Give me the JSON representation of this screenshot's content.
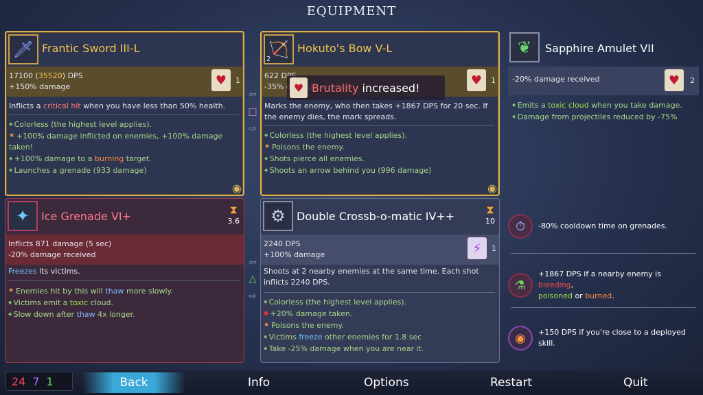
{
  "title": "EQUIPMENT",
  "sword": {
    "name": "Frantic Sword III-L",
    "dps_base": "17100",
    "dps_bonus": "35520",
    "dps_unit": "DPS",
    "damage": "+150% damage",
    "scroll_count": "1",
    "desc_pre": "Inflicts a ",
    "desc_hl": "critical hit",
    "desc_post": " when you have less than 50% health.",
    "mods": [
      "Colorless (the highest level applies).",
      "+100% damage inflicted on enemies, +100% damage taken!",
      "+100% damage to a ",
      "burning",
      " target.",
      "Launches a grenade (933 damage)"
    ]
  },
  "bow": {
    "name": "Hokuto's Bow V-L",
    "badge": "2",
    "dps": "622 DPS",
    "damage": "-35% damage received",
    "scroll_count": "1",
    "desc": "Marks the enemy, who then takes +1867 DPS for 20 sec. If the enemy dies, the mark spreads.",
    "mods": [
      "Colorless (the highest level applies).",
      "Poisons the enemy.",
      "Shots pierce all enemies.",
      "Shoots an arrow behind you (996 damage)"
    ]
  },
  "popup": {
    "word": "Brutality",
    "rest": " increased!"
  },
  "amulet": {
    "name": "Sapphire Amulet VII",
    "stat": "-20% damage received",
    "scroll_count": "2",
    "mods": [
      "Emits a ",
      "toxic cloud",
      " when you take damage.",
      "Damage from projectiles reduced by -75%"
    ]
  },
  "grenade": {
    "name": "Ice Grenade VI+",
    "timer": "3.6",
    "stat1": "Inflicts 871 damage (5 sec)",
    "stat2": "-20% damage received",
    "desc_hl": "Freezes",
    "desc_post": " its victims.",
    "mods": [
      "Enemies hit by this will ",
      "thaw",
      " more slowly.",
      "Victims emit a ",
      "toxic",
      " cloud.",
      "Slow down after ",
      "thaw",
      " 4x longer."
    ]
  },
  "crossbow": {
    "name": "Double Crossb-o-matic IV++",
    "timer": "10",
    "dps": "2240 DPS",
    "damage": "+100% damage",
    "scroll_count": "1",
    "desc": "Shoots at 2 nearby enemies at the same time. Each shot inflicts 2240 DPS.",
    "mods": [
      "Colorless (the highest level applies).",
      "+20% damage taken.",
      "Poisons the enemy.",
      "Victims ",
      "freeze",
      " other enemies for 1.8 sec",
      "Take -25% damage when you are near it."
    ]
  },
  "passives": [
    {
      "text": "-80% cooldown time on grenades."
    },
    {
      "pre": "+1867 DPS if a nearby enemy is ",
      "bleeding": "bleeding",
      "comma": ",",
      "poisoned": "poisoned",
      "or": " or ",
      "burned": "burned",
      "end": "."
    },
    {
      "text": "+150 DPS if you're close to a deployed skill."
    }
  ],
  "cells": {
    "red": "24",
    "purple": "7",
    "green": "1"
  },
  "menu": {
    "back": "Back",
    "info": "Info",
    "options": "Options",
    "restart": "Restart",
    "quit": "Quit"
  }
}
